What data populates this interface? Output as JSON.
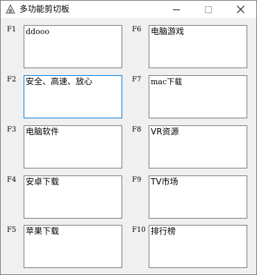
{
  "window": {
    "title": "多功能剪切板"
  },
  "titlebar_buttons": {
    "minimize": "minimize-icon",
    "maximize": "maximize-icon",
    "close": "close-icon"
  },
  "slots": [
    {
      "key": "F1",
      "value": "ddooo"
    },
    {
      "key": "F2",
      "value": "安全、高速、放心"
    },
    {
      "key": "F3",
      "value": "电脑软件"
    },
    {
      "key": "F4",
      "value": "安卓下载"
    },
    {
      "key": "F5",
      "value": "苹果下载"
    },
    {
      "key": "F6",
      "value": "电脑游戏"
    },
    {
      "key": "F7",
      "value": "mac下载"
    },
    {
      "key": "F8",
      "value": "VR资源"
    },
    {
      "key": "F9",
      "value": "TV市场"
    },
    {
      "key": "F10",
      "value": "排行榜"
    }
  ],
  "colors": {
    "focus_border": "#0078d7",
    "window_bg": "#f0f0f0"
  }
}
